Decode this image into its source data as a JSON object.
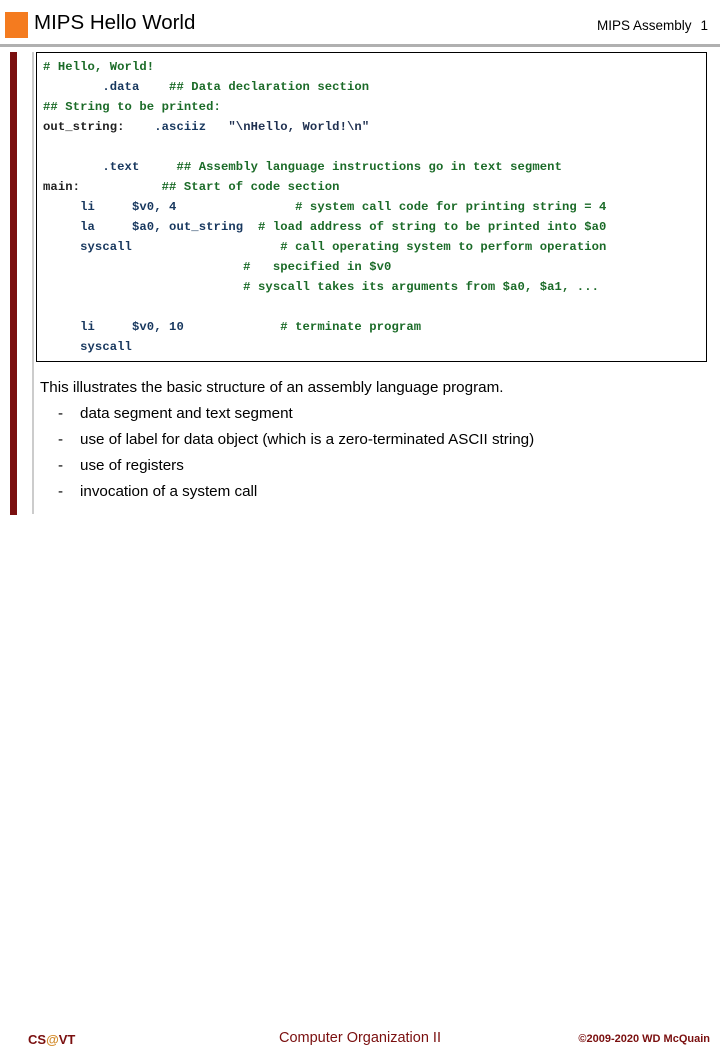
{
  "header": {
    "title": "MIPS Hello World",
    "course_label": "MIPS Assembly",
    "page_number": "1"
  },
  "code": {
    "language": "MIPS Assembly",
    "lines": [
      [
        {
          "t": "# Hello, World!",
          "c": "comment"
        }
      ],
      [
        {
          "t": "        ",
          "c": "plain"
        },
        {
          "t": ".data",
          "c": "directive"
        },
        {
          "t": "    ",
          "c": "plain"
        },
        {
          "t": "## Data declaration section",
          "c": "comment"
        }
      ],
      [
        {
          "t": "## String to be printed:",
          "c": "comment"
        }
      ],
      [
        {
          "t": "out_string:",
          "c": "label"
        },
        {
          "t": "    ",
          "c": "plain"
        },
        {
          "t": ".asciiz",
          "c": "directive"
        },
        {
          "t": "   ",
          "c": "plain"
        },
        {
          "t": "\"\\nHello, World!\\n\"",
          "c": "string"
        }
      ],
      [],
      [
        {
          "t": "        ",
          "c": "plain"
        },
        {
          "t": ".text",
          "c": "directive"
        },
        {
          "t": "     ",
          "c": "plain"
        },
        {
          "t": "## Assembly language instructions go in text segment",
          "c": "comment"
        }
      ],
      [
        {
          "t": "main:",
          "c": "label"
        },
        {
          "t": "           ",
          "c": "plain"
        },
        {
          "t": "## Start of code section",
          "c": "comment"
        }
      ],
      [
        {
          "t": "     ",
          "c": "plain"
        },
        {
          "t": "li",
          "c": "instr"
        },
        {
          "t": "     ",
          "c": "plain"
        },
        {
          "t": "$v0, 4",
          "c": "operand"
        },
        {
          "t": "                ",
          "c": "plain"
        },
        {
          "t": "# system call code for printing string = 4",
          "c": "comment"
        }
      ],
      [
        {
          "t": "     ",
          "c": "plain"
        },
        {
          "t": "la",
          "c": "instr"
        },
        {
          "t": "     ",
          "c": "plain"
        },
        {
          "t": "$a0, out_string",
          "c": "operand"
        },
        {
          "t": "  ",
          "c": "plain"
        },
        {
          "t": "# load address of string to be printed into $a0",
          "c": "comment"
        }
      ],
      [
        {
          "t": "     ",
          "c": "plain"
        },
        {
          "t": "syscall",
          "c": "instr"
        },
        {
          "t": "                    ",
          "c": "plain"
        },
        {
          "t": "# call operating system to perform operation",
          "c": "comment"
        }
      ],
      [
        {
          "t": "                           ",
          "c": "plain"
        },
        {
          "t": "#   specified in $v0",
          "c": "comment"
        }
      ],
      [
        {
          "t": "                           ",
          "c": "plain"
        },
        {
          "t": "# syscall takes its arguments from $a0, $a1, ...",
          "c": "comment"
        }
      ],
      [],
      [
        {
          "t": "     ",
          "c": "plain"
        },
        {
          "t": "li",
          "c": "instr"
        },
        {
          "t": "     ",
          "c": "plain"
        },
        {
          "t": "$v0, 10",
          "c": "operand"
        },
        {
          "t": "             ",
          "c": "plain"
        },
        {
          "t": "# terminate program",
          "c": "comment"
        }
      ],
      [
        {
          "t": "     ",
          "c": "plain"
        },
        {
          "t": "syscall",
          "c": "instr"
        }
      ]
    ]
  },
  "body": {
    "intro": "This illustrates the basic structure of an assembly language program.",
    "dash": "-",
    "bullets": [
      "data segment and text segment",
      "use of label for data object (which is a zero-terminated ASCII string)",
      "use of registers",
      "invocation of a system call"
    ]
  },
  "footer": {
    "logo_prefix": "CS",
    "logo_at": "@",
    "logo_suffix": "VT",
    "center": "Computer Organization II",
    "copyright": "©2009-2020 WD McQuain"
  },
  "colors": {
    "accent_orange": "#F47B1F",
    "accent_dark_red": "#7A0F0F",
    "comment_green": "#1B6B28",
    "code_navy": "#17375E",
    "logo_gold": "#D38B2B",
    "rule_gray": "#B0B0B0"
  }
}
